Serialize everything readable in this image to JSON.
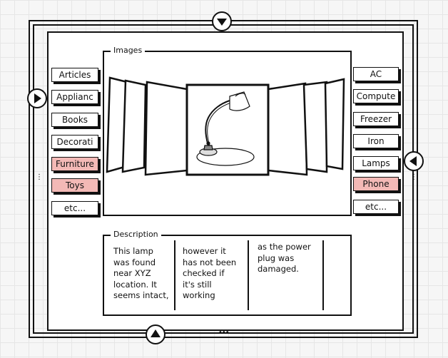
{
  "images": {
    "legend": "Images"
  },
  "left_categories": [
    {
      "label": "Articles",
      "selected": false
    },
    {
      "label": "Applianc",
      "selected": false
    },
    {
      "label": "Books",
      "selected": false
    },
    {
      "label": "Decorati",
      "selected": false
    },
    {
      "label": "Furniture",
      "selected": true
    },
    {
      "label": "Toys",
      "selected": true
    },
    {
      "label": "etc...",
      "selected": false
    }
  ],
  "right_categories": [
    {
      "label": "AC",
      "selected": false
    },
    {
      "label": "Compute",
      "selected": false
    },
    {
      "label": "Freezer",
      "selected": false
    },
    {
      "label": "Iron",
      "selected": false
    },
    {
      "label": "Lamps",
      "selected": false
    },
    {
      "label": "Phone",
      "selected": true
    },
    {
      "label": "etc...",
      "selected": false
    }
  ],
  "description": {
    "legend": "Description",
    "columns": [
      "This lamp\nwas found\nnear XYZ\nlocation. It\nseems intact,",
      "however it\nhas not been\nchecked if\nit's still\nworking",
      "as the power\nplug was\ndamaged."
    ]
  },
  "colors": {
    "selected_fill": "#f3b9b6",
    "stroke": "#111111"
  }
}
